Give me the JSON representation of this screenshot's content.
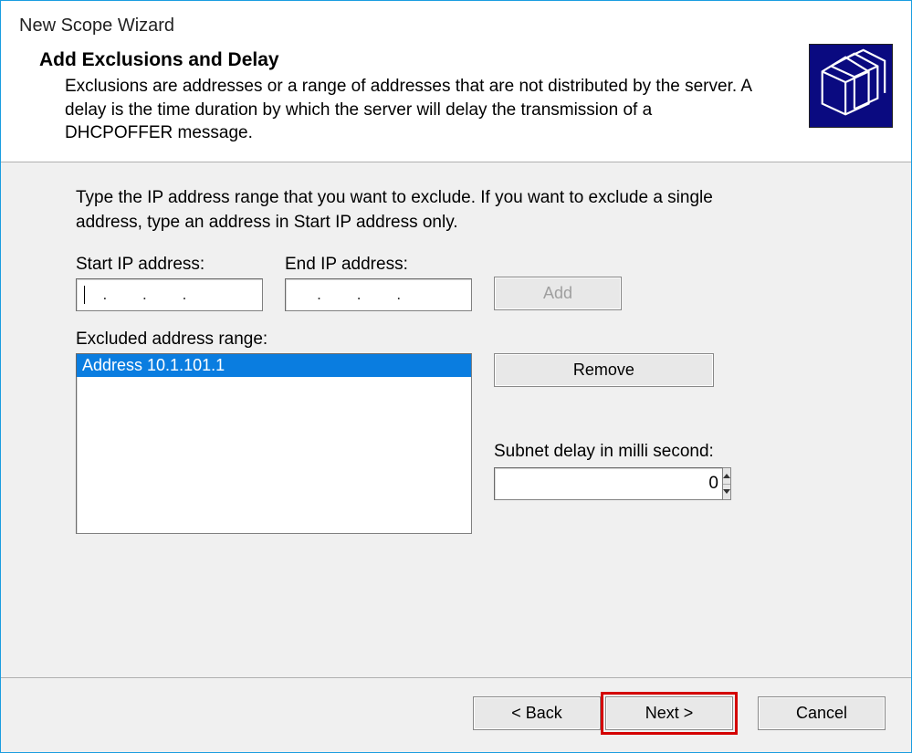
{
  "window": {
    "title": "New Scope Wizard"
  },
  "header": {
    "title": "Add Exclusions and Delay",
    "description": "Exclusions are addresses or a range of addresses that are not distributed by the server. A delay is the time duration by which the server will delay the transmission of a DHCPOFFER message."
  },
  "body": {
    "instruction": "Type the IP address range that you want to exclude. If you want to exclude a single address, type an address in Start IP address only.",
    "start_ip_label": "Start IP address:",
    "end_ip_label": "End IP address:",
    "start_ip_value": "",
    "end_ip_value": "",
    "add_label": "Add",
    "excluded_label": "Excluded address range:",
    "excluded_items": [
      "Address 10.1.101.1"
    ],
    "remove_label": "Remove",
    "subnet_delay_label": "Subnet delay in milli second:",
    "subnet_delay_value": "0"
  },
  "footer": {
    "back_label": "< Back",
    "next_label": "Next >",
    "cancel_label": "Cancel"
  }
}
